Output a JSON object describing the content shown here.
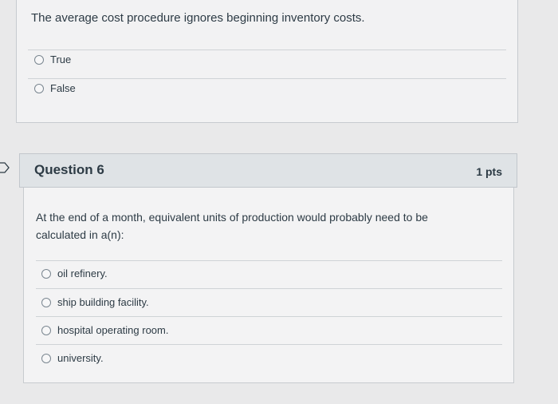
{
  "question5": {
    "text": "The average cost procedure ignores beginning inventory costs.",
    "options": [
      {
        "label": "True"
      },
      {
        "label": "False"
      }
    ]
  },
  "question6": {
    "title": "Question 6",
    "points": "1 pts",
    "text": "At the end of a month, equivalent units of production would probably need to be calculated in a(n):",
    "options": [
      {
        "label": "oil refinery."
      },
      {
        "label": "ship building facility."
      },
      {
        "label": "hospital operating room."
      },
      {
        "label": "university."
      }
    ]
  }
}
